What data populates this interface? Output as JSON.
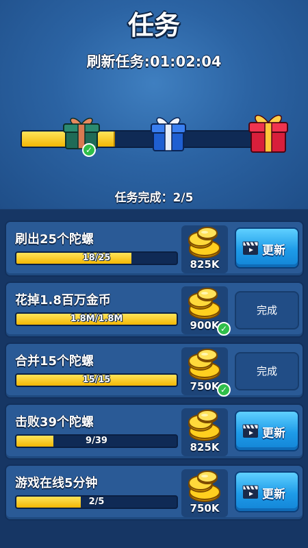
{
  "header": {
    "title": "任务",
    "refresh_label": "刷新任务:01:02:04",
    "completion_label": "任务完成：2/5",
    "track_progress": 0.37,
    "gifts": [
      {
        "name": "green-gift",
        "claimed": true
      },
      {
        "name": "blue-gift",
        "claimed": false
      },
      {
        "name": "red-gift",
        "claimed": false
      }
    ]
  },
  "tasks": [
    {
      "name": "刷出25个陀螺",
      "progress_text": "18/25",
      "progress": 0.72,
      "reward": "825K",
      "state": "refresh",
      "button_label": "更新"
    },
    {
      "name": "花掉1.8百万金币",
      "progress_text": "1.8M/1.8M",
      "progress": 1.0,
      "reward": "900K",
      "state": "done",
      "button_label": "完成"
    },
    {
      "name": "合并15个陀螺",
      "progress_text": "15/15",
      "progress": 1.0,
      "reward": "750K",
      "state": "done",
      "button_label": "完成"
    },
    {
      "name": "击败39个陀螺",
      "progress_text": "9/39",
      "progress": 0.23,
      "reward": "825K",
      "state": "refresh",
      "button_label": "更新"
    },
    {
      "name": "游戏在线5分钟",
      "progress_text": "2/5",
      "progress": 0.4,
      "reward": "750K",
      "state": "refresh",
      "button_label": "更新"
    }
  ],
  "colors": {
    "accent_gold": "#f2b705",
    "button_blue": "#1e9be8",
    "check_green": "#2fbf4a"
  }
}
